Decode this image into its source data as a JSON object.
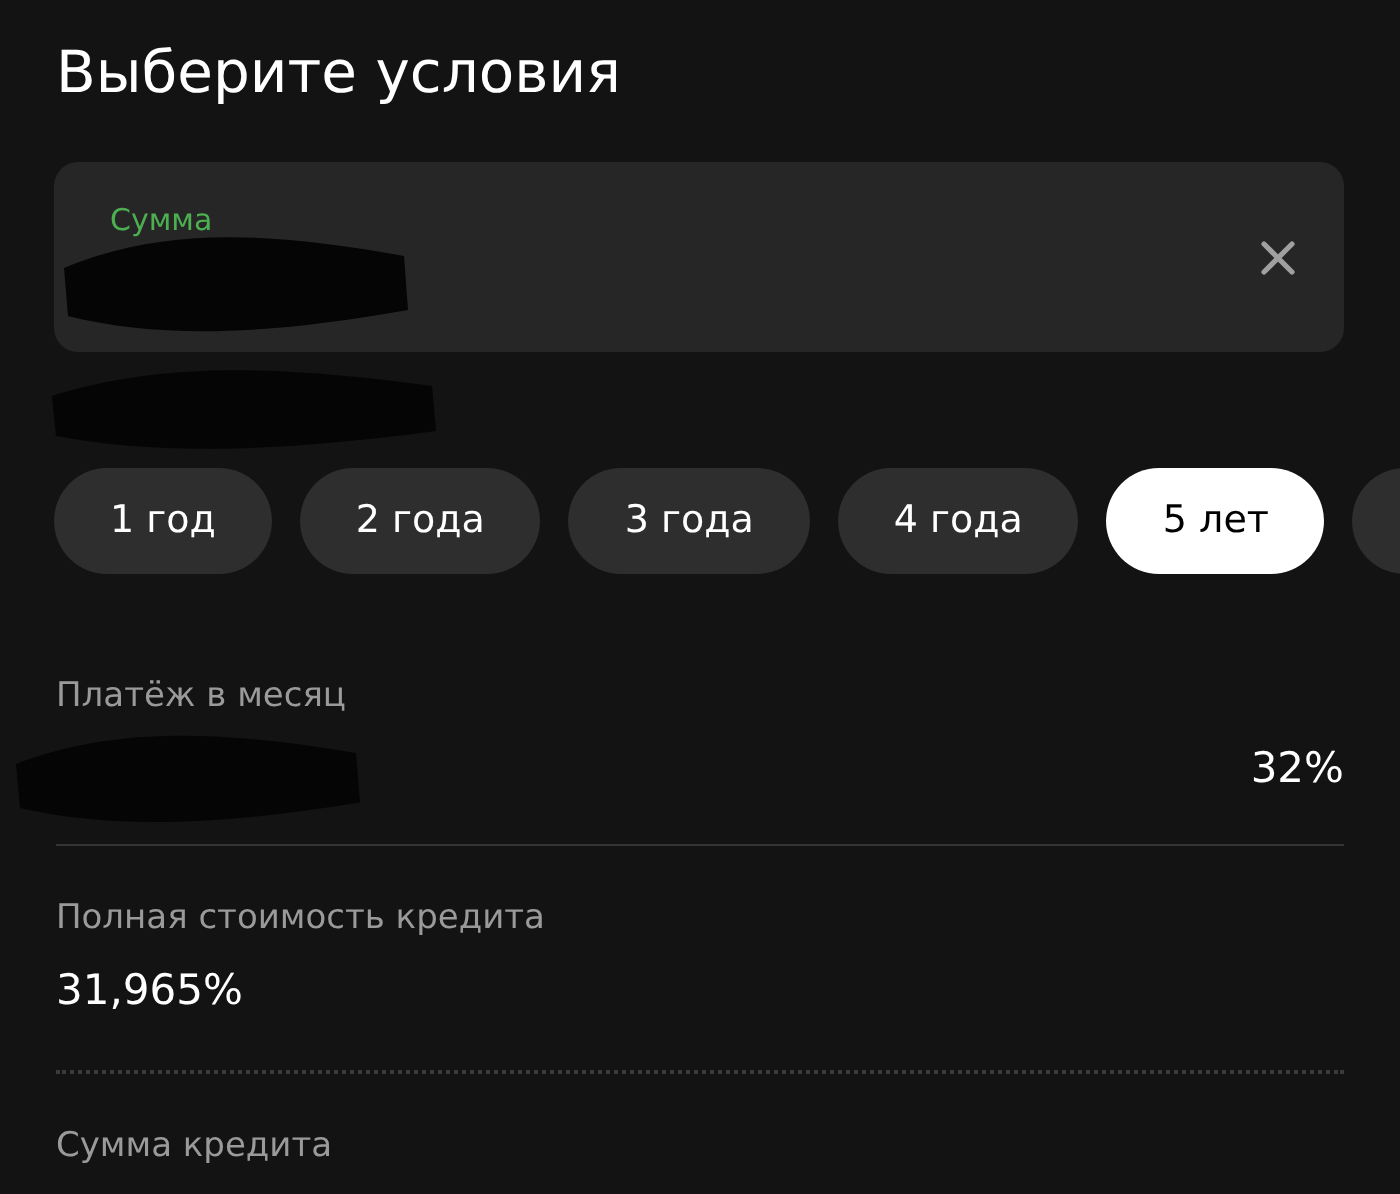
{
  "title": "Выберите условия",
  "amount_field": {
    "label": "Сумма"
  },
  "terms": [
    {
      "label": "1 год",
      "selected": false
    },
    {
      "label": "2 года",
      "selected": false
    },
    {
      "label": "3 года",
      "selected": false
    },
    {
      "label": "4 года",
      "selected": false
    },
    {
      "label": "5 лет",
      "selected": true
    }
  ],
  "details": [
    {
      "kind": "trailing",
      "label": "Платёж в месяц",
      "value": "32%"
    },
    {
      "kind": "stacked",
      "label": "Полная стоимость кредита",
      "value": "31,965%"
    },
    {
      "kind": "plain",
      "label": "Сумма кредита"
    }
  ]
}
